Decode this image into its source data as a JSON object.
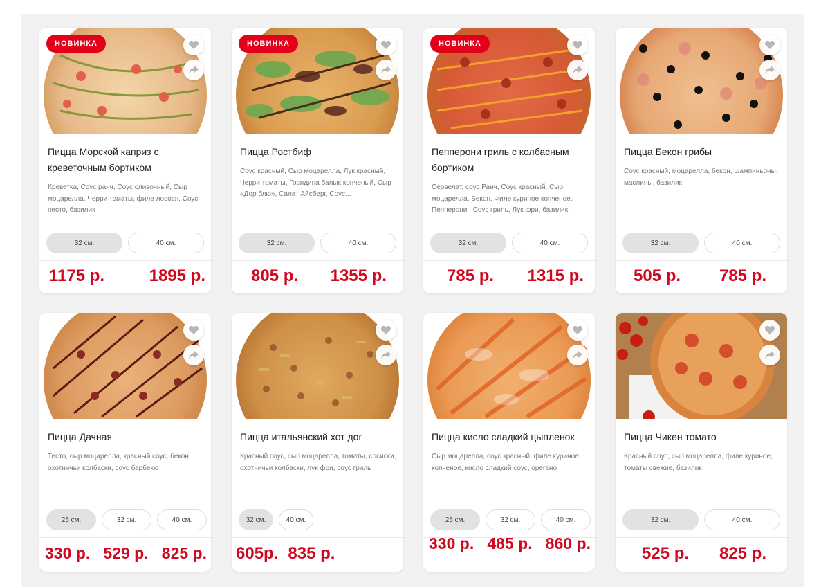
{
  "badge_label": "НОВИНКА",
  "colors": {
    "accent": "#e3001b",
    "price": "#d0071f"
  },
  "products": [
    {
      "title": "Пицца Морской каприз с креветочным бортиком",
      "description": "Креветка, Соус ранч, Соус сливочный, Сыр моцарелла, Черри томаты, филе лосося, Соус песто, базилик",
      "badge": true,
      "sizes": [
        "32 см.",
        "40 см."
      ],
      "prices": [
        "1175 р.",
        "1895 р."
      ]
    },
    {
      "title": "Пицца Ростбиф",
      "description": "Соус красный, Сыр моцарелла, Лук красный, Черри томаты, Говядина балык копченый, Сыр «Дор блю», Салат Айсберг, Соус...",
      "badge": true,
      "sizes": [
        "32 см.",
        "40 см."
      ],
      "prices": [
        "805 р.",
        "1355 р."
      ]
    },
    {
      "title": "Пепперони гриль с колбасным бортиком",
      "description": "Сервелат, соус Ранч, Соус красный, Сыр моцарелла, Бекон, Филе куриное копченое, Пепперони , Соус гриль, Лук фри, базилик",
      "badge": true,
      "sizes": [
        "32 см.",
        "40 см."
      ],
      "prices": [
        "785 р.",
        "1315 р."
      ]
    },
    {
      "title": "Пицца Бекон грибы",
      "description": "Соус красный, моцарелла, бекон, шампиньоны, маслины, базилик",
      "badge": false,
      "sizes": [
        "32 см.",
        "40 см."
      ],
      "prices": [
        "505 р.",
        "785 р."
      ]
    },
    {
      "title": "Пицца Дачная",
      "description": "Тесто, сыр моцарелла, красный соус, бекон, охотничьи колбаски, соус барбекю",
      "badge": false,
      "sizes": [
        "25 см.",
        "32 см.",
        "40 см."
      ],
      "prices": [
        "330 р.",
        "529 р.",
        "825 р."
      ]
    },
    {
      "title": "Пицца итальянский хот дог",
      "description": "Красный соус, сыр моцарелла, томаты, сосиски, охотничьи колбаски, лук фри, соус гриль",
      "badge": false,
      "sizes": [
        "32 см.",
        "40 см."
      ],
      "prices": [
        "605р.",
        "835 р."
      ]
    },
    {
      "title": "Пицца кисло сладкий цыпленок",
      "description": "Сыр моцарелла, соус красный, филе куриное копченое, кисло сладкий соус, орегано",
      "badge": false,
      "sizes": [
        "25 см.",
        "32 см.",
        "40 см."
      ],
      "prices": [
        "330 р.",
        "485 р.",
        "860 р."
      ]
    },
    {
      "title": "Пицца Чикен томато",
      "description": "Красный соус, сыр моцарелла, филе куриное, томаты свежие, базилик",
      "badge": false,
      "sizes": [
        "32 см.",
        "40 см."
      ],
      "prices": [
        "525 р.",
        "825 р."
      ]
    }
  ]
}
